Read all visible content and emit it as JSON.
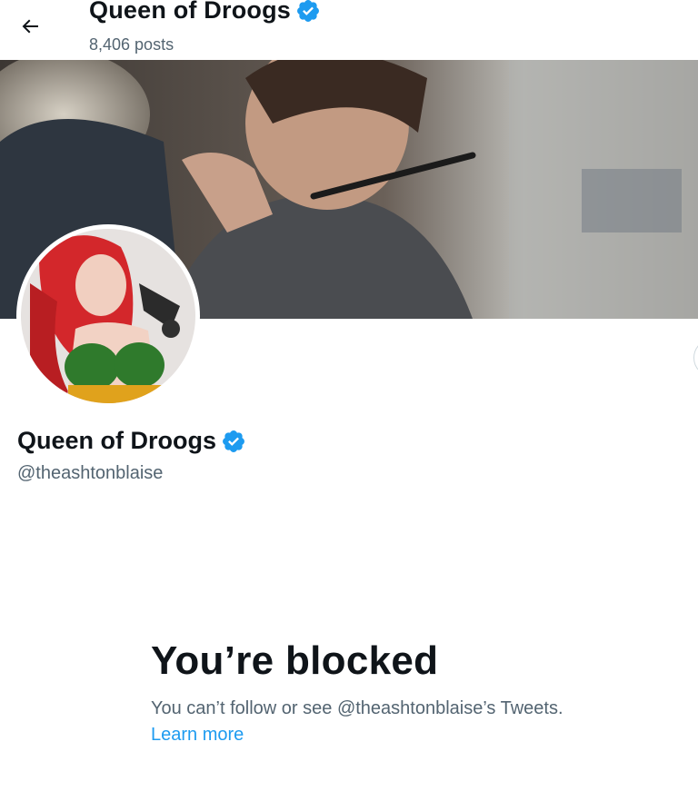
{
  "header": {
    "display_name": "Queen of Droogs",
    "post_count": "8,406 posts",
    "back_icon": "arrow-left-icon",
    "verified_icon": "verified-badge-icon"
  },
  "profile": {
    "display_name": "Queen of Droogs",
    "handle": "@theashtonblaise"
  },
  "blocked": {
    "title": "You’re blocked",
    "message": "You can’t follow or see @theashtonblaise’s Tweets.",
    "link": "Learn more"
  },
  "colors": {
    "accent": "#1d9bf0",
    "text_primary": "#0f1419",
    "text_secondary": "#536471"
  }
}
